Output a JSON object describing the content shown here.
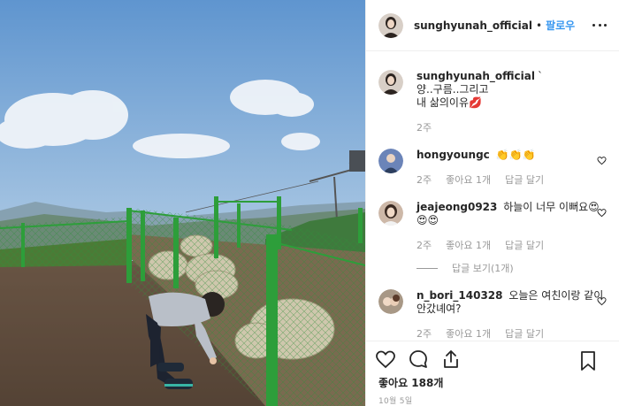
{
  "post": {
    "username": "sunghyunah_official",
    "follow_label": "팔로우",
    "separator": "•",
    "caption_user": "sunghyunah_official",
    "caption_mark": "`",
    "caption_line1": "양..구름..그리고",
    "caption_line2": "내 삶의이유💋",
    "caption_time": "2주",
    "likes_text": "좋아요 188개",
    "date_text": "10월 5일"
  },
  "comments": [
    {
      "user": "hongyoungc",
      "text": "👏👏👏",
      "time": "2주",
      "likes": "좋아요 1개",
      "reply": "답글 달기"
    },
    {
      "user": "jeajeong0923",
      "text": "하늘이 너무 이뻐요😍😍😍",
      "time": "2주",
      "likes": "좋아요 1개",
      "reply": "답글 달기",
      "view_replies": "답글 보기(1개)"
    },
    {
      "user": "n_bori_140328",
      "text": "오늘은 여친이랑 같이 안갔녜여?",
      "time": "2주",
      "likes": "좋아요 1개",
      "reply": "답글 달기"
    }
  ],
  "icons": {
    "more": "more-horizontal-icon",
    "like": "heart-outline-icon",
    "comment": "comment-bubble-icon",
    "share": "share-icon",
    "save": "bookmark-icon",
    "comment_like": "small-heart-icon"
  },
  "colors": {
    "link": "#3897f0",
    "text": "#262626",
    "muted": "#999999",
    "border": "#efefef"
  }
}
